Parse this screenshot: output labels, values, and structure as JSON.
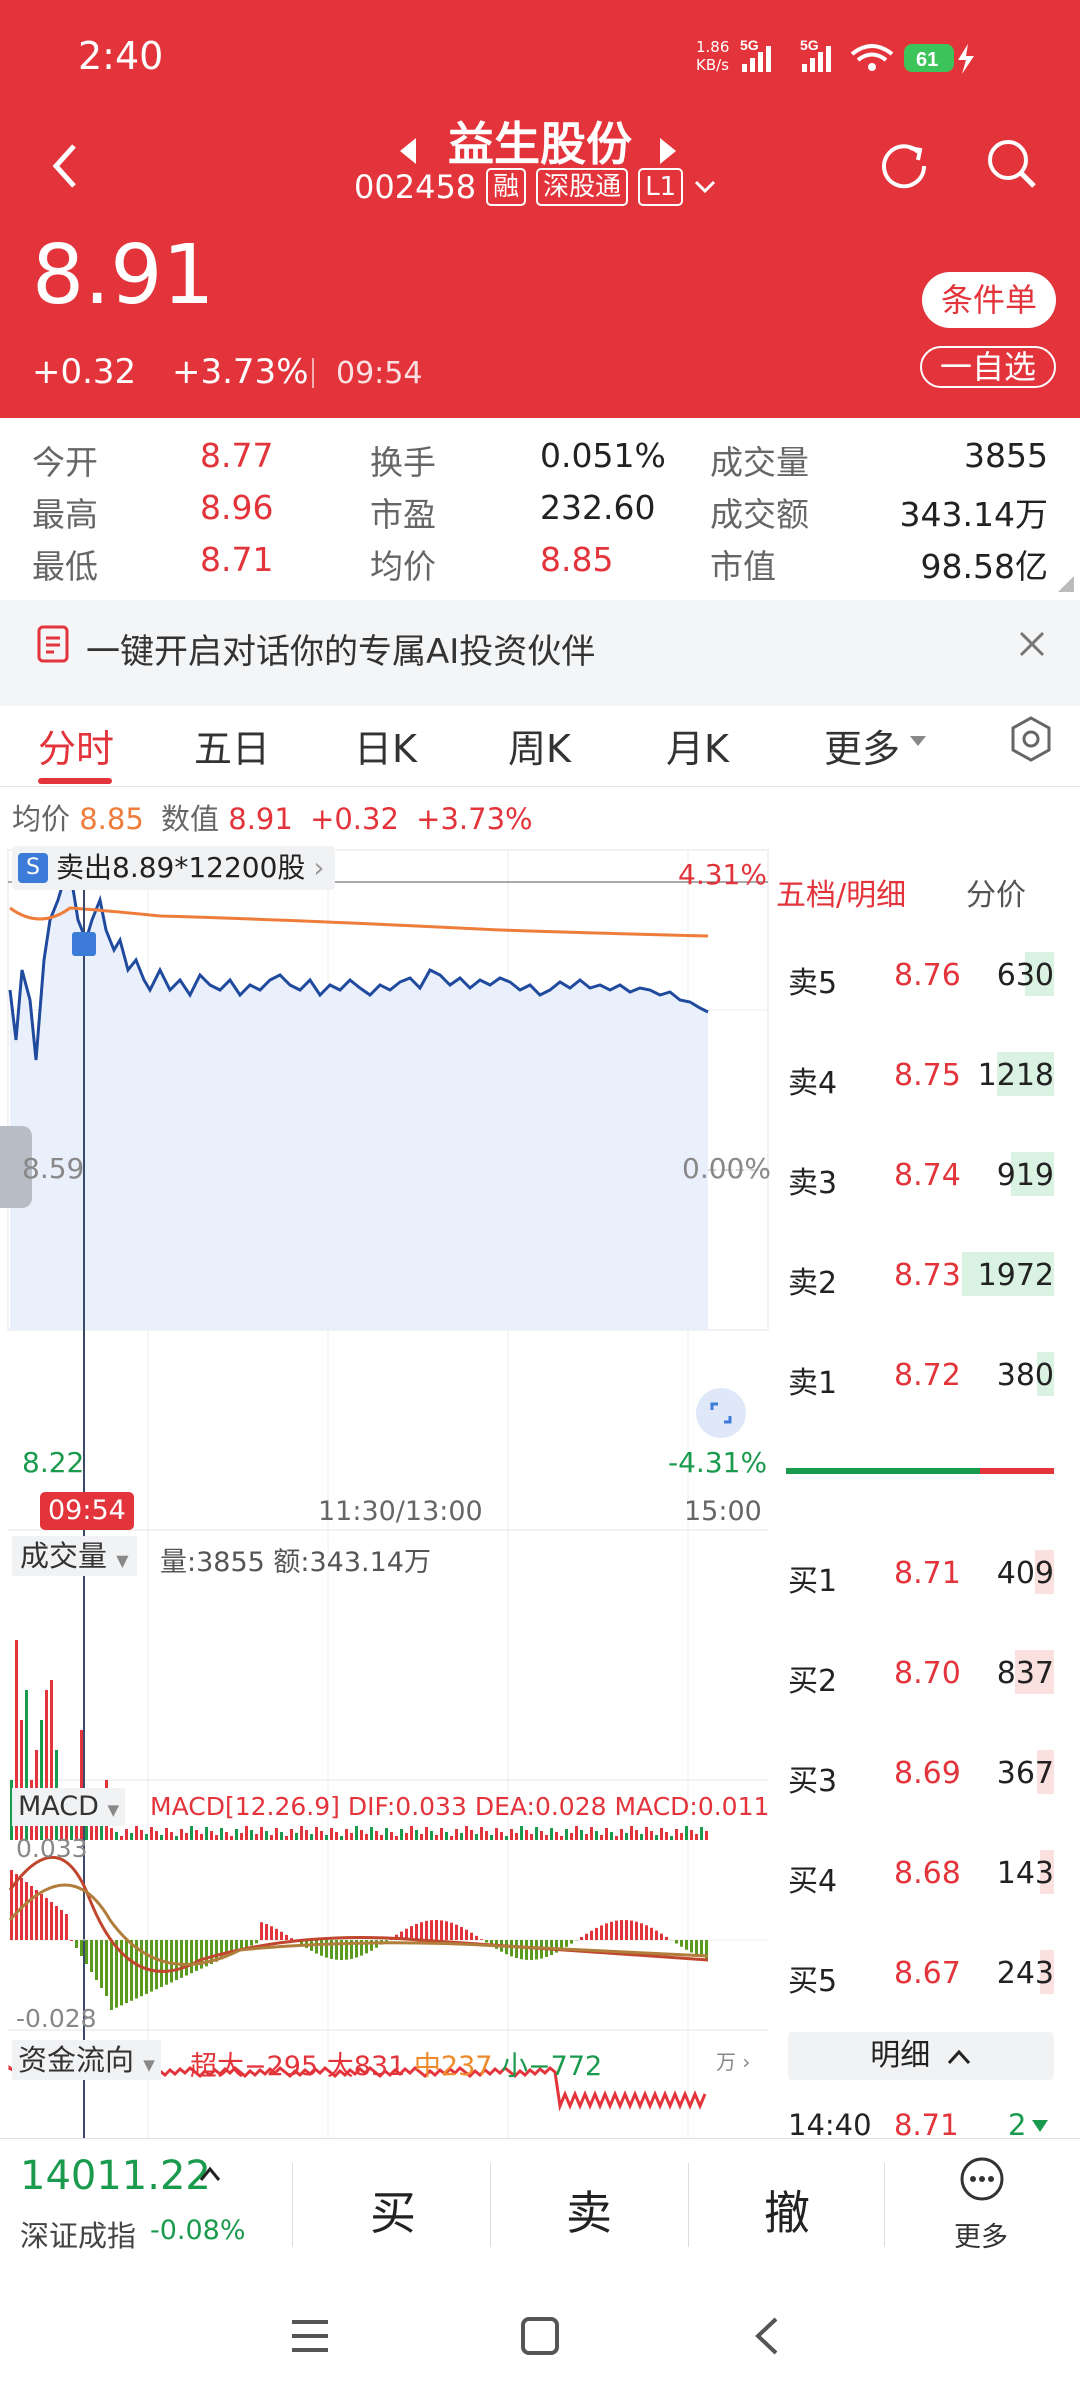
{
  "status_bar": {
    "time": "2:40",
    "net_speed": "1.86\nKB/s",
    "signal1": "5G",
    "signal2": "5G",
    "battery": "61"
  },
  "header": {
    "title": "益生股份",
    "code": "002458",
    "tags": [
      "融",
      "深股通",
      "L1"
    ],
    "price": "8.91",
    "change": "+0.32",
    "change_pct": "+3.73%",
    "time": "09:54",
    "cond_btn": "条件单",
    "watch_btn": "一自选"
  },
  "stats": [
    {
      "label": "今开",
      "value": "8.77",
      "color": "red"
    },
    {
      "label": "换手",
      "value": "0.051%",
      "color": "black"
    },
    {
      "label": "成交量",
      "value": "3855",
      "color": "black"
    },
    {
      "label": "最高",
      "value": "8.96",
      "color": "red"
    },
    {
      "label": "市盈",
      "value": "232.60",
      "color": "black"
    },
    {
      "label": "成交额",
      "value": "343.14万",
      "color": "black"
    },
    {
      "label": "最低",
      "value": "8.71",
      "color": "red"
    },
    {
      "label": "均价",
      "value": "8.85",
      "color": "red"
    },
    {
      "label": "市值",
      "value": "98.58亿",
      "color": "black"
    }
  ],
  "ai_banner": "一键开启对话你的专属AI投资伙伴",
  "tabs": [
    "分时",
    "五日",
    "日K",
    "周K",
    "月K",
    "更多"
  ],
  "info_line": {
    "avg_label": "均价",
    "avg_value": "8.85",
    "num_label": "数值",
    "num_value": "8.91",
    "chg": "+0.32",
    "pct": "+3.73%"
  },
  "chart": {
    "trade_tip": "卖出8.89*12200股",
    "max_pct": "4.31%",
    "min_pct": "-4.31%",
    "mid_price": "8.59",
    "mid_pct": "0.00%",
    "low_price": "8.22",
    "time_marker": "09:54",
    "x_mid": "11:30/13:00",
    "x_end": "15:00",
    "volume_label": "成交量",
    "volume_info": "量:3855 额:343.14万",
    "macd_label": "MACD",
    "macd_info": "MACD[12.26.9] DIF:0.033 DEA:0.028 MACD:0.011",
    "macd_max": "0.033",
    "macd_min": "-0.028",
    "fund_label": "资金流向",
    "fund_super": "超大−295",
    "fund_big": "大831",
    "fund_mid": "中237",
    "fund_small": "小−772",
    "fund_unit": "万"
  },
  "orderbook": {
    "header_left": "五档/明细",
    "header_right": "分价",
    "asks": [
      {
        "label": "卖5",
        "price": "8.76",
        "vol": "630",
        "frac": 0.32
      },
      {
        "label": "卖4",
        "price": "8.75",
        "vol": "1218",
        "frac": 0.62
      },
      {
        "label": "卖3",
        "price": "8.74",
        "vol": "919",
        "frac": 0.47
      },
      {
        "label": "卖2",
        "price": "8.73",
        "vol": "1972",
        "frac": 1.0
      },
      {
        "label": "卖1",
        "price": "8.72",
        "vol": "380",
        "frac": 0.19
      }
    ],
    "bids": [
      {
        "label": "买1",
        "price": "8.71",
        "vol": "409",
        "frac": 0.21
      },
      {
        "label": "买2",
        "price": "8.70",
        "vol": "837",
        "frac": 0.42
      },
      {
        "label": "买3",
        "price": "8.69",
        "vol": "367",
        "frac": 0.19
      },
      {
        "label": "买4",
        "price": "8.68",
        "vol": "143",
        "frac": 0.07
      },
      {
        "label": "买5",
        "price": "8.67",
        "vol": "243",
        "frac": 0.12
      }
    ],
    "detail_label": "明细",
    "detail_row": {
      "time": "14:40",
      "price": "8.71",
      "vol": "2"
    }
  },
  "bottom": {
    "index_value": "14011.22",
    "index_name": "深证成指",
    "index_pct": "-0.08%",
    "buy": "买",
    "sell": "卖",
    "cancel": "撤",
    "more": "更多"
  },
  "colors": {
    "brand_red": "#e3343b",
    "up_red": "#e3343b",
    "down_green": "#1a9a4c",
    "price_line": "#1f4a9e",
    "avg_line": "#ee7d3b"
  }
}
